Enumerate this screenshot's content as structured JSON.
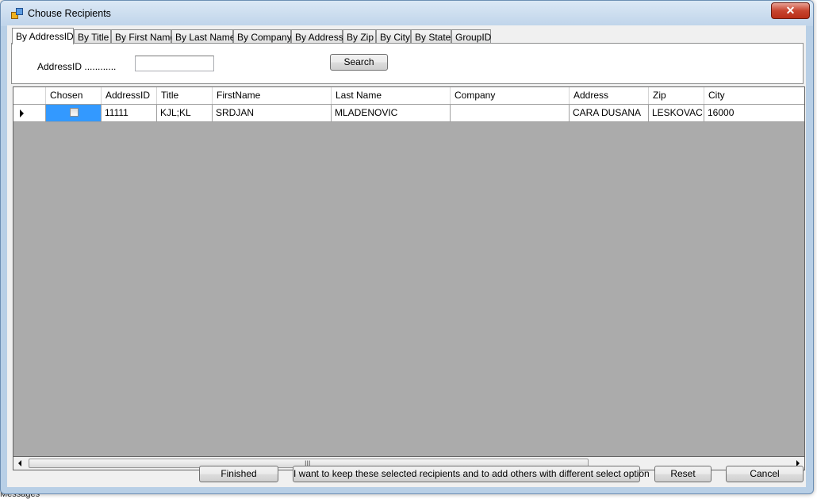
{
  "background": {
    "bottom_text": "Messages"
  },
  "window": {
    "title": "Chouse Recipients",
    "close_label": "✕"
  },
  "tabs": [
    {
      "label": "By AddressID",
      "active": true
    },
    {
      "label": "By Title"
    },
    {
      "label": "By First Name"
    },
    {
      "label": "By Last Name"
    },
    {
      "label": "By Company"
    },
    {
      "label": "By Address"
    },
    {
      "label": "By Zip"
    },
    {
      "label": "By City"
    },
    {
      "label": "By State"
    },
    {
      "label": "GroupID"
    }
  ],
  "filter": {
    "label": "AddressID ............",
    "value": "",
    "search_label": "Search"
  },
  "grid": {
    "columns": [
      "Chosen",
      "AddressID",
      "Title",
      "FirstName",
      "Last Name",
      "Company",
      "Address",
      "Zip",
      "City"
    ],
    "rows": [
      {
        "chosen": false,
        "cells": [
          "11111",
          "KJL;KL",
          "SRDJAN",
          "MLADENOVIC",
          "",
          "CARA DUSANA",
          "LESKOVAC",
          "16000"
        ]
      }
    ],
    "scroll_grip": "III"
  },
  "footer": {
    "finished_label": "Finished",
    "keep_label": "I want to keep these selected recipients and to add others with different select option",
    "reset_label": "Reset",
    "cancel_label": "Cancel"
  }
}
